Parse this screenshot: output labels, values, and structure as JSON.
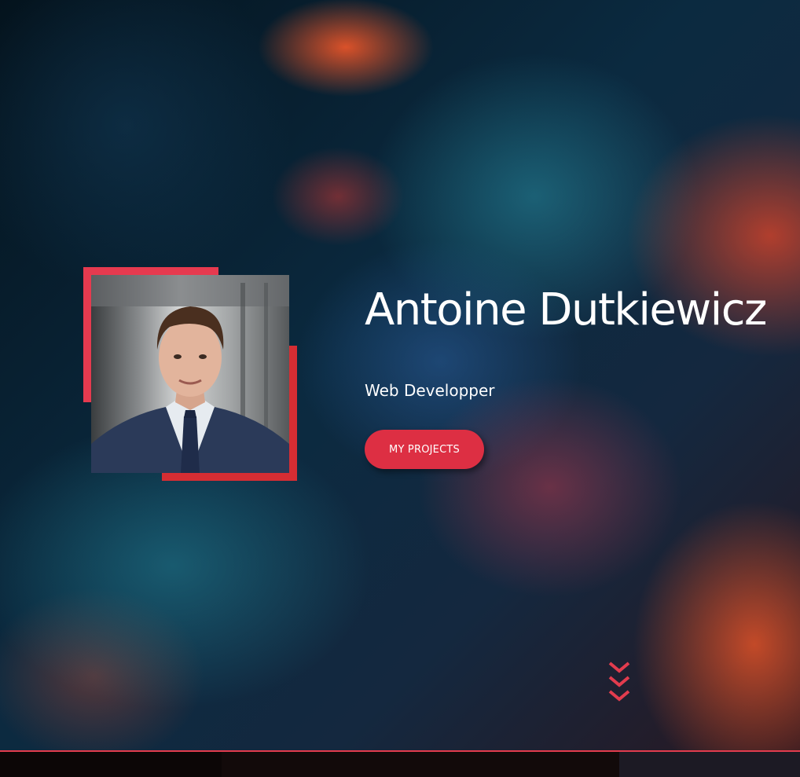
{
  "hero": {
    "name": "Antoine Dutkiewicz",
    "role": "Web Developper",
    "cta_label": "MY PROJECTS"
  },
  "icons": {
    "scroll": "chevrons-down-icon",
    "photo": "profile-photo"
  },
  "colors": {
    "accent": "#e63a4f",
    "accent_dark": "#d62d33",
    "text": "#ffffff",
    "background": "#06121a"
  }
}
